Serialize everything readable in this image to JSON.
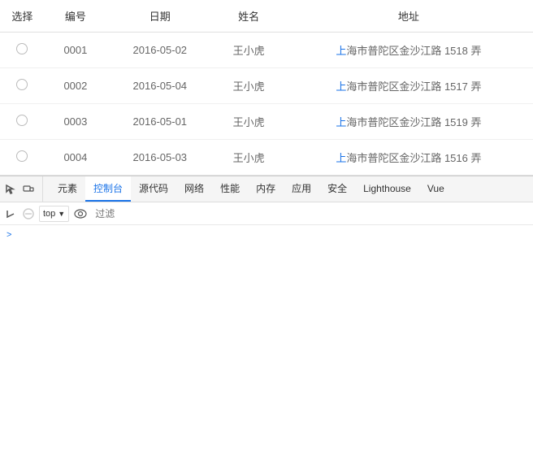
{
  "table": {
    "headers": {
      "select": "选择",
      "id": "编号",
      "date": "日期",
      "name": "姓名",
      "address": "地址"
    },
    "rows": [
      {
        "id": "0001",
        "date": "2016-05-02",
        "name": "王小虎",
        "address_prefix": "上",
        "address_rest": "海市普陀区金沙江路 1518 弄"
      },
      {
        "id": "0002",
        "date": "2016-05-04",
        "name": "王小虎",
        "address_prefix": "上",
        "address_rest": "海市普陀区金沙江路 1517 弄"
      },
      {
        "id": "0003",
        "date": "2016-05-01",
        "name": "王小虎",
        "address_prefix": "上",
        "address_rest": "海市普陀区金沙江路 1519 弄"
      },
      {
        "id": "0004",
        "date": "2016-05-03",
        "name": "王小虎",
        "address_prefix": "上",
        "address_rest": "海市普陀区金沙江路 1516 弄"
      }
    ]
  },
  "devtools": {
    "tabs": [
      {
        "label": "元素",
        "active": false
      },
      {
        "label": "控制台",
        "active": true
      },
      {
        "label": "源代码",
        "active": false
      },
      {
        "label": "网络",
        "active": false
      },
      {
        "label": "性能",
        "active": false
      },
      {
        "label": "内存",
        "active": false
      },
      {
        "label": "应用",
        "active": false
      },
      {
        "label": "安全",
        "active": false
      },
      {
        "label": "Lighthouse",
        "active": false
      },
      {
        "label": "Vue",
        "active": false
      }
    ],
    "console": {
      "context": "top",
      "filter_placeholder": "过滤"
    }
  }
}
